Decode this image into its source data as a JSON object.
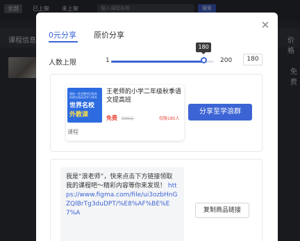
{
  "background": {
    "filters": [
      "全部",
      "已上架",
      "未上架"
    ],
    "search_placeholder": "输入课程名称",
    "search_button": "搜索",
    "col_course_info": "课程信息",
    "col_price": "价格",
    "price_value": "免费"
  },
  "modal": {
    "tabs": [
      "0元分享",
      "原价分享"
    ],
    "active_tab": 0,
    "limit_label": "人数上限",
    "slider": {
      "min": "1",
      "max": "200",
      "value": 180,
      "display": "180"
    },
    "course": {
      "cover_small_text": "刷新一条完整知识链条 搭建全面英语学习体系",
      "cover_line1": "世界名校",
      "cover_line2": "外教课",
      "title": "王老师的小学二年级秋季语文提高班",
      "price": "免费",
      "original_price": "999元",
      "limit_text": "仅限180人",
      "type": "课程"
    },
    "share_button": "分享至学浪群",
    "invite_text": "我是“浪老师”，快来点击下方链接领取我的课程吧～精彩内容等你来发现！",
    "invite_link": "https://www.figma.com/file/ui3ozbHnGZQlBrTg3duDPT/%E8%AF%BE%E7%A",
    "copy_button": "复制商品链接"
  },
  "colors": {
    "accent": "#3c64d4",
    "danger": "#e8473a"
  },
  "icons": {
    "close": "close-icon"
  }
}
